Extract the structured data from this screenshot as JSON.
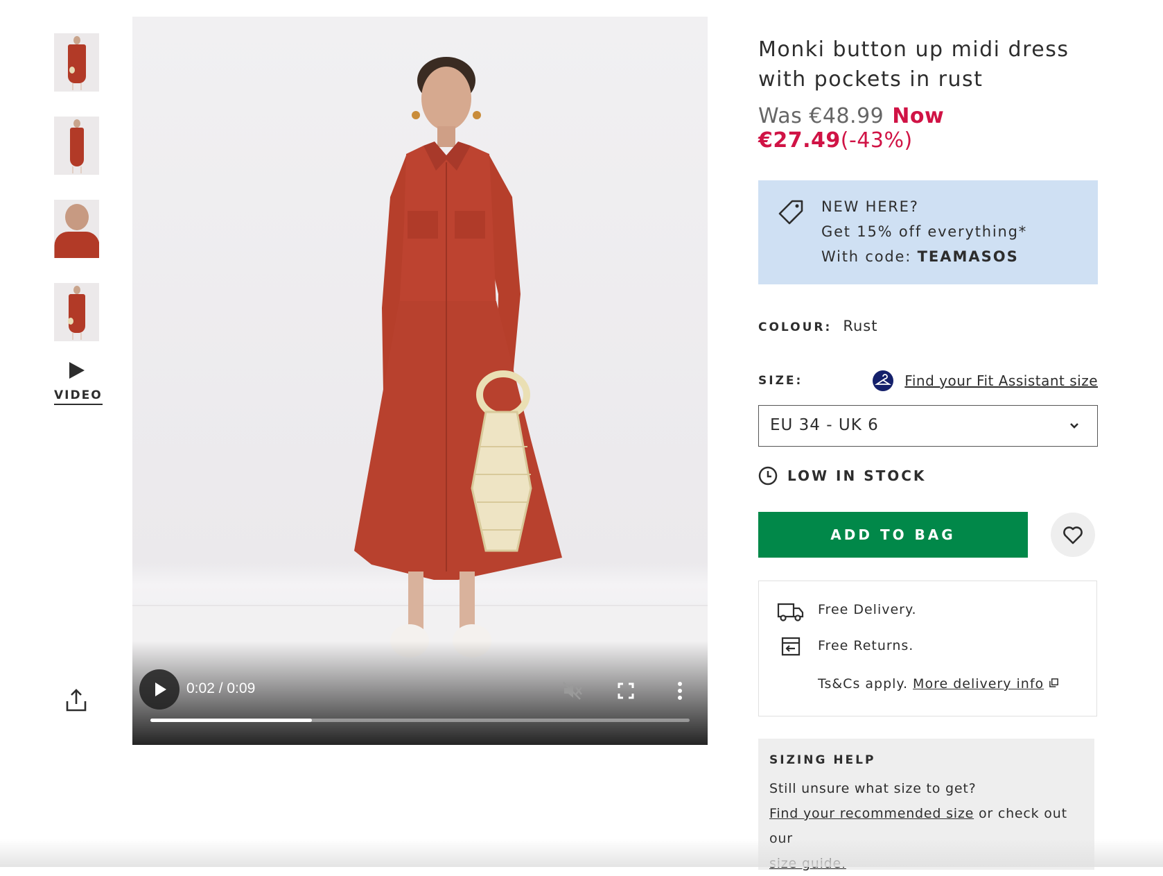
{
  "gallery": {
    "thumbnails": [
      "thumb-1",
      "thumb-2",
      "thumb-3",
      "thumb-4"
    ],
    "video_tab_label": "VIDEO",
    "share_icon": "share-icon"
  },
  "video": {
    "current_time": "0:02",
    "duration": "0:09",
    "time_display": "0:02 / 0:09",
    "progress_fraction": 0.3,
    "muted": true,
    "icons": [
      "play-icon",
      "mute-icon",
      "fullscreen-icon",
      "more-options-icon"
    ]
  },
  "product": {
    "title": "Monki button up midi dress with pockets in rust",
    "price": {
      "was_label": "Was €48.99",
      "now_label": "Now €27.49",
      "discount": "(-43%)"
    }
  },
  "promo": {
    "line1": "NEW HERE?",
    "line2": "Get 15% off everything*",
    "line3_prefix": "With code: ",
    "code": "TEAMASOS",
    "icon": "price-tag-icon",
    "background": "#cfe0f3"
  },
  "colour": {
    "label": "COLOUR:",
    "value": "Rust"
  },
  "size": {
    "label": "SIZE:",
    "fit_assistant_link": "Find your Fit Assistant size",
    "selected": "EU 34 - UK 6"
  },
  "stock": {
    "label": "LOW IN STOCK"
  },
  "actions": {
    "add_to_bag": "ADD TO BAG",
    "add_to_bag_color": "#018849",
    "save_icon": "heart-icon"
  },
  "delivery": {
    "free_delivery": "Free Delivery.",
    "free_returns": "Free Returns.",
    "terms_prefix": "Ts&Cs apply. ",
    "more_info_link": "More delivery info"
  },
  "sizing_help": {
    "heading": "SIZING HELP",
    "line1": "Still unsure what size to get?",
    "recommended_link": "Find your recommended size",
    "middle": " or check out our",
    "size_guide_link": "size guide."
  },
  "colors": {
    "sale_red": "#d01345",
    "text": "#2d2d2d"
  }
}
